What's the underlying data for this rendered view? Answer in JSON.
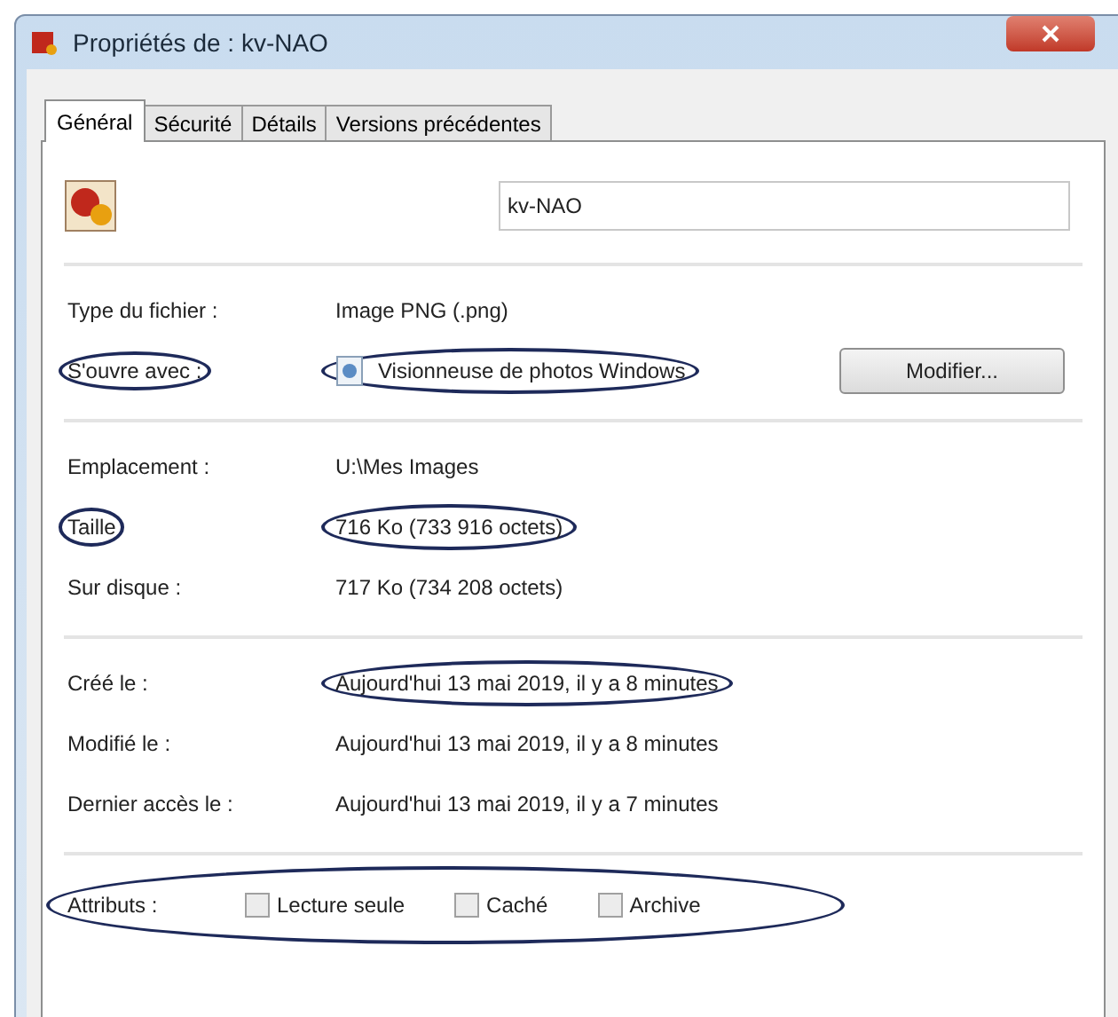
{
  "window": {
    "title": "Propriétés de : kv-NAO"
  },
  "tabs": [
    {
      "label": "Général",
      "selected": true
    },
    {
      "label": "Sécurité",
      "selected": false
    },
    {
      "label": "Détails",
      "selected": false
    },
    {
      "label": "Versions précédentes",
      "selected": false
    }
  ],
  "file_name": {
    "value": "kv-NAO"
  },
  "sections": [
    [
      {
        "label": "Type du fichier :",
        "value": "Image PNG (.png)",
        "label_circled": false,
        "value_circled": false
      },
      {
        "label": "S'ouvre avec :",
        "value": "Visionneuse de photos Windows",
        "label_circled": true,
        "value_circled": true,
        "kind": "app",
        "button": "Modifier..."
      }
    ],
    [
      {
        "label": "Emplacement :",
        "value": "U:\\Mes Images",
        "label_circled": false,
        "value_circled": false
      },
      {
        "label": "Taille",
        "value": "716 Ko (733 916 octets)",
        "label_circled": true,
        "value_circled": true
      },
      {
        "label": "Sur disque :",
        "value": "717 Ko (734 208 octets)",
        "label_circled": false,
        "value_circled": false
      }
    ],
    [
      {
        "label": "Créé le :",
        "value": "Aujourd'hui 13 mai 2019, il y a 8 minutes",
        "label_circled": false,
        "value_circled": true
      },
      {
        "label": "Modifié le :",
        "value": "Aujourd'hui 13 mai 2019, il y a 8 minutes",
        "label_circled": false,
        "value_circled": false
      },
      {
        "label": "Dernier accès le :",
        "value": "Aujourd'hui 13 mai 2019, il y a 7 minutes",
        "label_circled": false,
        "value_circled": false
      }
    ]
  ],
  "attributes": {
    "label": "Attributs :",
    "circled": true,
    "items": [
      {
        "label": "Lecture seule",
        "checked": false
      },
      {
        "label": "Caché",
        "checked": false
      },
      {
        "label": "Archive",
        "checked": false
      }
    ]
  }
}
